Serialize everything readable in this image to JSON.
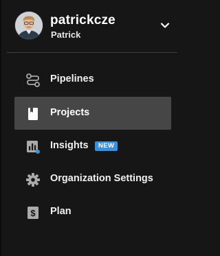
{
  "account": {
    "username": "patrickcze",
    "display_name": "Patrick",
    "avatar_alt": "Profile photo"
  },
  "nav": {
    "items": [
      {
        "label": "Pipelines",
        "icon": "pipelines-icon"
      },
      {
        "label": "Projects",
        "icon": "projects-icon",
        "active": true
      },
      {
        "label": "Insights",
        "icon": "insights-icon",
        "badge": "NEW"
      },
      {
        "label": "Organization Settings",
        "icon": "gear-icon"
      },
      {
        "label": "Plan",
        "icon": "dollar-icon"
      }
    ]
  },
  "colors": {
    "background": "#161616",
    "active_item": "#464646",
    "badge": "#3f8fd6",
    "icon": "#aaaaaa"
  }
}
